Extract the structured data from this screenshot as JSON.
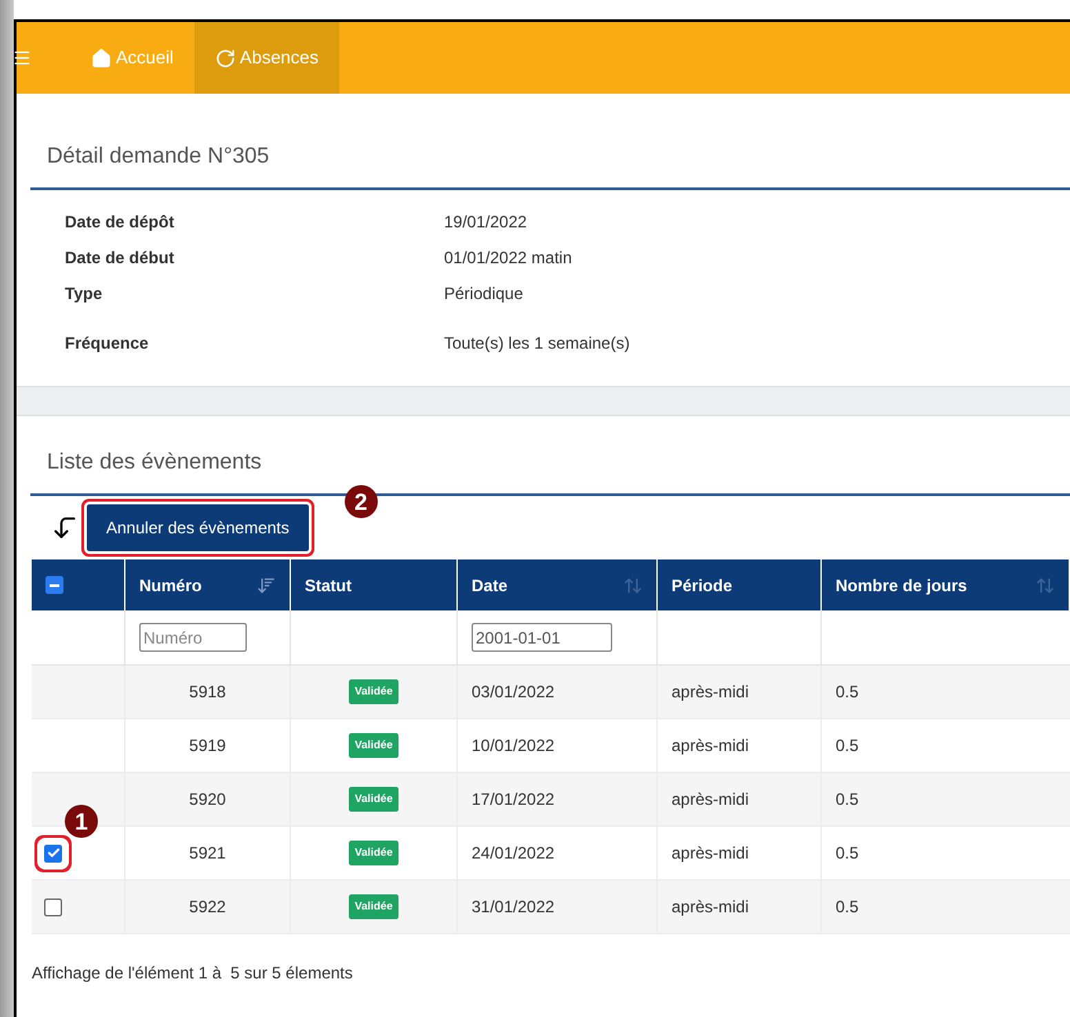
{
  "nav": {
    "items": [
      {
        "label": "Accueil",
        "selected": false
      },
      {
        "label": "Absences",
        "selected": true
      }
    ]
  },
  "detail": {
    "title": "Détail demande N°305",
    "fields": [
      {
        "label": "Date de dépôt",
        "value": "19/01/2022"
      },
      {
        "label": "Date de début",
        "value": "01/01/2022 matin"
      },
      {
        "label": "Type",
        "value": "Périodique"
      },
      {
        "label": "Fréquence",
        "value": "Toute(s) les 1 semaine(s)"
      }
    ]
  },
  "events": {
    "title": "Liste des évènements",
    "action_button": "Annuler des évènements",
    "action_callout": "2",
    "select_all": {
      "indeterminate": true
    },
    "columns": [
      {
        "label": "Numéro",
        "kind": "sorted"
      },
      {
        "label": "Statut",
        "kind": "plain"
      },
      {
        "label": "Date",
        "kind": "sortable"
      },
      {
        "label": "Période",
        "kind": "plain"
      },
      {
        "label": "Nombre de jours",
        "kind": "sortable"
      }
    ],
    "filters": {
      "number": {
        "placeholder": "Numéro"
      },
      "date": {
        "value": "2001-01-01"
      }
    },
    "rows": [
      {
        "kind": "plain",
        "number": "5918",
        "status": "Validée",
        "date": "03/01/2022",
        "period": "après-midi",
        "days": "0.5"
      },
      {
        "kind": "plain",
        "number": "5919",
        "status": "Validée",
        "date": "10/01/2022",
        "period": "après-midi",
        "days": "0.5"
      },
      {
        "kind": "plain",
        "number": "5920",
        "status": "Validée",
        "date": "17/01/2022",
        "period": "après-midi",
        "days": "0.5"
      },
      {
        "kind": "checkbox",
        "checked": true,
        "callout": "1",
        "number": "5921",
        "status": "Validée",
        "date": "24/01/2022",
        "period": "après-midi",
        "days": "0.5"
      },
      {
        "kind": "checkbox",
        "checked": false,
        "number": "5922",
        "status": "Validée",
        "date": "31/01/2022",
        "period": "après-midi",
        "days": "0.5"
      }
    ],
    "footer": "Affichage de l'élément 1 à  5 sur 5 élements"
  }
}
